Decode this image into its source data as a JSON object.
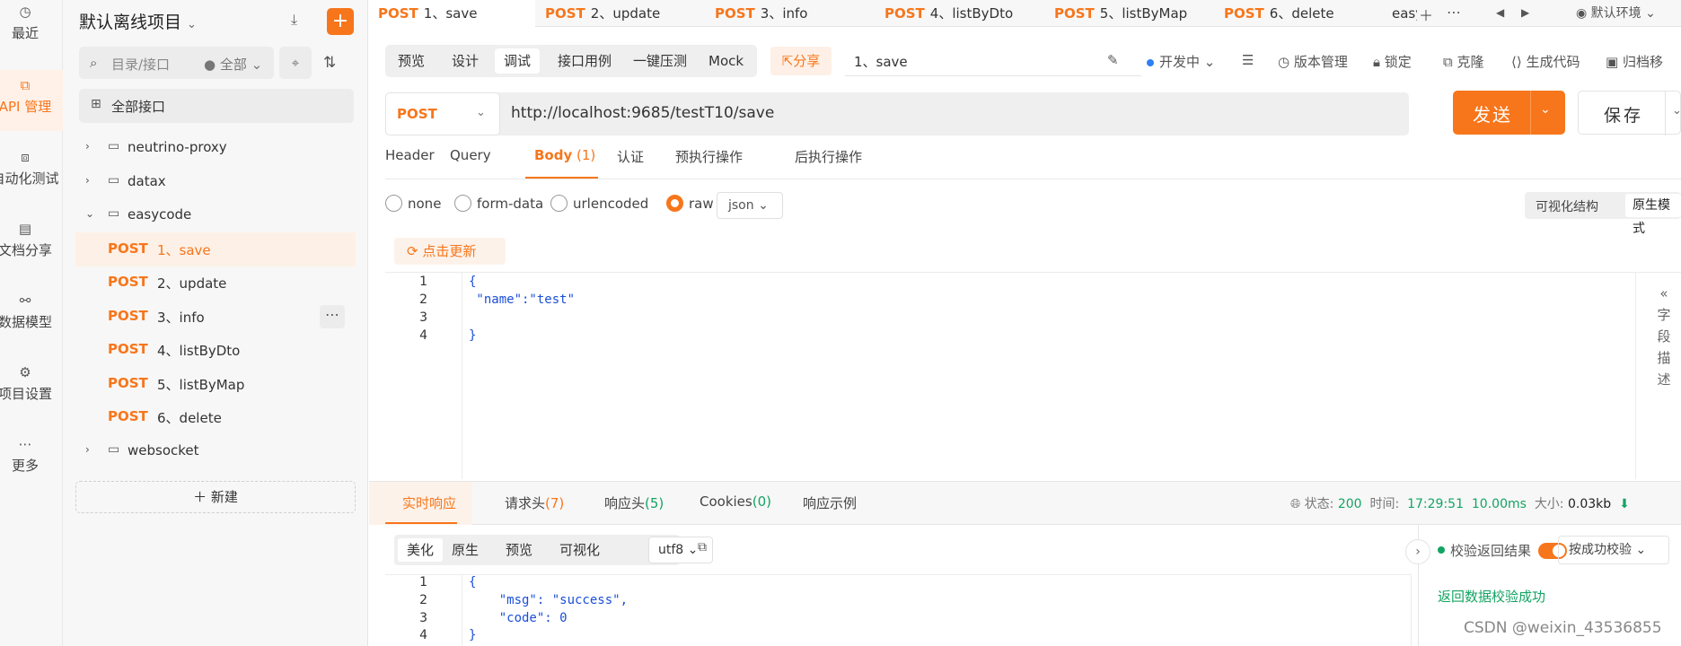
{
  "rail": {
    "items": [
      {
        "label": "最近",
        "icon": "clock-icon"
      },
      {
        "label": "API 管理",
        "icon": "api-icon"
      },
      {
        "label": "自动化测试",
        "icon": "flow-icon"
      },
      {
        "label": "文档分享",
        "icon": "doc-icon"
      },
      {
        "label": "数据模型",
        "icon": "model-icon"
      },
      {
        "label": "项目设置",
        "icon": "settings-icon"
      },
      {
        "label": "更多",
        "icon": "more-icon"
      }
    ]
  },
  "sidebar": {
    "project_title": "默认离线项目",
    "search_placeholder": "目录/接口",
    "filter_label": "全部",
    "all_api_label": "全部接口",
    "tree": [
      {
        "type": "folder",
        "label": "neutrino-proxy",
        "expanded": false
      },
      {
        "type": "folder",
        "label": "datax",
        "expanded": false
      },
      {
        "type": "folder",
        "label": "easycode",
        "expanded": true
      },
      {
        "type": "api",
        "method": "POST",
        "label": "1、save",
        "selected": true
      },
      {
        "type": "api",
        "method": "POST",
        "label": "2、update"
      },
      {
        "type": "api",
        "method": "POST",
        "label": "3、info"
      },
      {
        "type": "api",
        "method": "POST",
        "label": "4、listByDto"
      },
      {
        "type": "api",
        "method": "POST",
        "label": "5、listByMap"
      },
      {
        "type": "api",
        "method": "POST",
        "label": "6、delete"
      },
      {
        "type": "folder",
        "label": "websocket",
        "expanded": false
      }
    ],
    "new_label": "新建"
  },
  "tabs": [
    {
      "method": "POST",
      "label": "1、save"
    },
    {
      "method": "POST",
      "label": "2、update"
    },
    {
      "method": "POST",
      "label": "3、info"
    },
    {
      "method": "POST",
      "label": "4、listByDto"
    },
    {
      "method": "POST",
      "label": "5、listByMap"
    },
    {
      "method": "POST",
      "label": "6、delete"
    },
    {
      "method": "",
      "label": "easy"
    }
  ],
  "env_label": "默认环境",
  "subtabs": [
    "预览",
    "设计",
    "调试",
    "接口用例",
    "一键压测",
    "Mock"
  ],
  "share_label": "分享",
  "current_name": "1、save",
  "toolbar": {
    "status": "开发中",
    "version": "版本管理",
    "lock": "锁定",
    "clone": "克隆",
    "gencode": "生成代码",
    "archive": "归档移"
  },
  "request": {
    "method": "POST",
    "url": "http://localhost:9685/testT10/save",
    "send_label": "发送",
    "save_label": "保存"
  },
  "req_tabs": [
    "Header",
    "Query",
    "Body (1)",
    "认证",
    "预执行操作",
    "后执行操作"
  ],
  "body_types": [
    "none",
    "form-data",
    "urlencoded",
    "raw"
  ],
  "body_format": "json",
  "view_modes": [
    "可视化结构",
    "原生模式"
  ],
  "update_label": "点击更新",
  "request_body_lines": [
    "{",
    " \"name\":\"test\"",
    "",
    "}"
  ],
  "field_desc": "字段描述",
  "response": {
    "tabs": [
      "实时响应",
      "请求头(7)",
      "响应头(5)",
      "Cookies(0)",
      "响应示例"
    ],
    "status_label": "状态:",
    "status": "200",
    "time_label": "时间:",
    "time": "17:29:51",
    "duration": "10.00ms",
    "size_label": "大小:",
    "size": "0.03kb",
    "formats": [
      "美化",
      "原生",
      "预览",
      "可视化"
    ],
    "encoding": "utf8",
    "lines": [
      "{",
      "    \"msg\": \"success\",",
      "    \"code\": 0",
      "}"
    ],
    "validate_label": "校验返回结果",
    "check_mode": "按成功校验",
    "validate_result": "返回数据校验成功"
  },
  "watermark": "CSDN @weixin_43536855"
}
